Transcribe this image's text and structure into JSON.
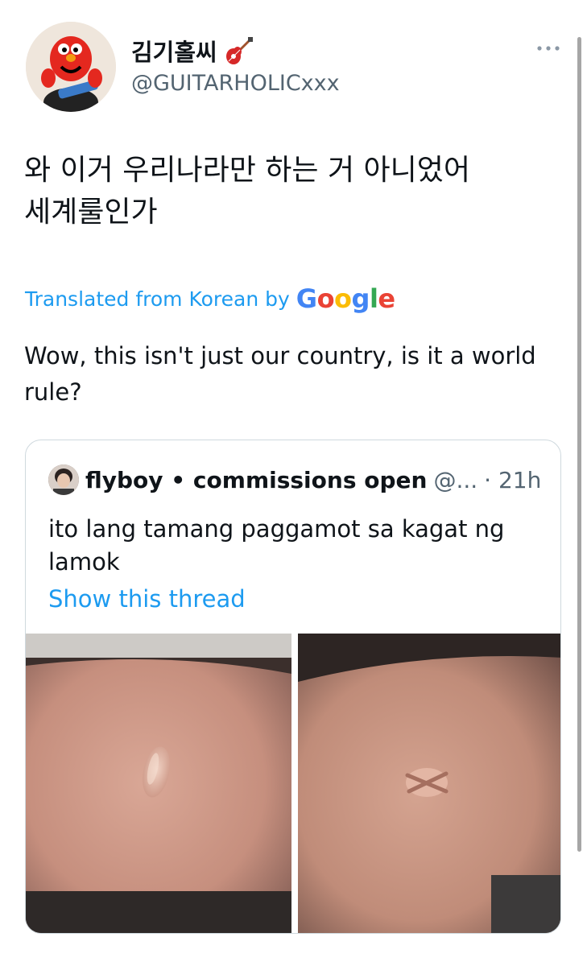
{
  "author": {
    "display_name": "김기홀씨",
    "handle": "@GUITARHOLICxxx"
  },
  "tweet": {
    "text": "와 이거 우리나라만 하는 거 아니었어\n세계룰인가",
    "translated_prefix": "Translated from Korean by",
    "google_label": "Google",
    "translation": "Wow, this isn't just our country, is it a world rule?"
  },
  "quote": {
    "name": "flyboy • commissions open",
    "handle": "@...",
    "time": "· 21h",
    "text": "ito lang tamang paggamot sa kagat ng lamok",
    "show_thread": "Show this thread"
  },
  "icons": {
    "more": "more-horizontal-icon",
    "guitar": "guitar-emoji-icon"
  },
  "colors": {
    "link": "#1d9bf0",
    "secondary_text": "#536471",
    "border": "#cfd9de"
  }
}
